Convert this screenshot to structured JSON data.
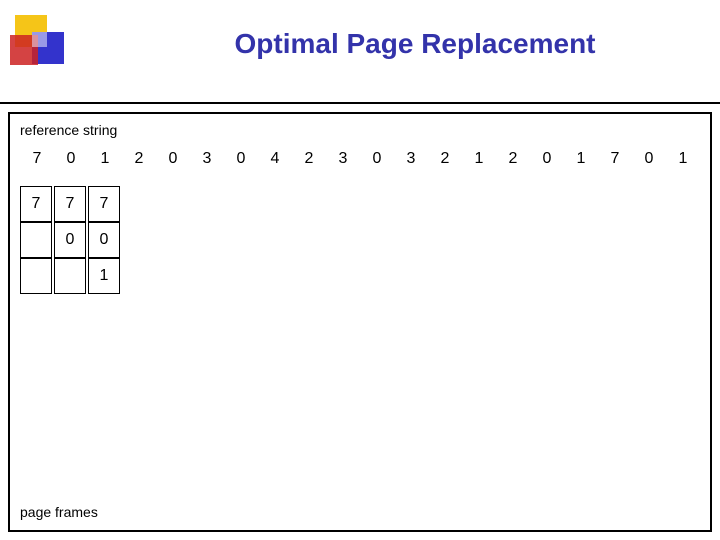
{
  "header": {
    "title": "Optimal Page Replacement"
  },
  "reference_string": {
    "label": "reference string",
    "numbers": [
      7,
      0,
      1,
      2,
      0,
      3,
      0,
      4,
      2,
      3,
      0,
      3,
      2,
      1,
      2,
      0,
      1,
      7,
      0,
      1
    ]
  },
  "page_frames": {
    "label": "page frames",
    "columns": [
      {
        "cells": [
          "7",
          "",
          ""
        ]
      },
      {
        "cells": [
          "7",
          "0",
          ""
        ]
      },
      {
        "cells": [
          "7",
          "0",
          "1"
        ]
      }
    ]
  }
}
